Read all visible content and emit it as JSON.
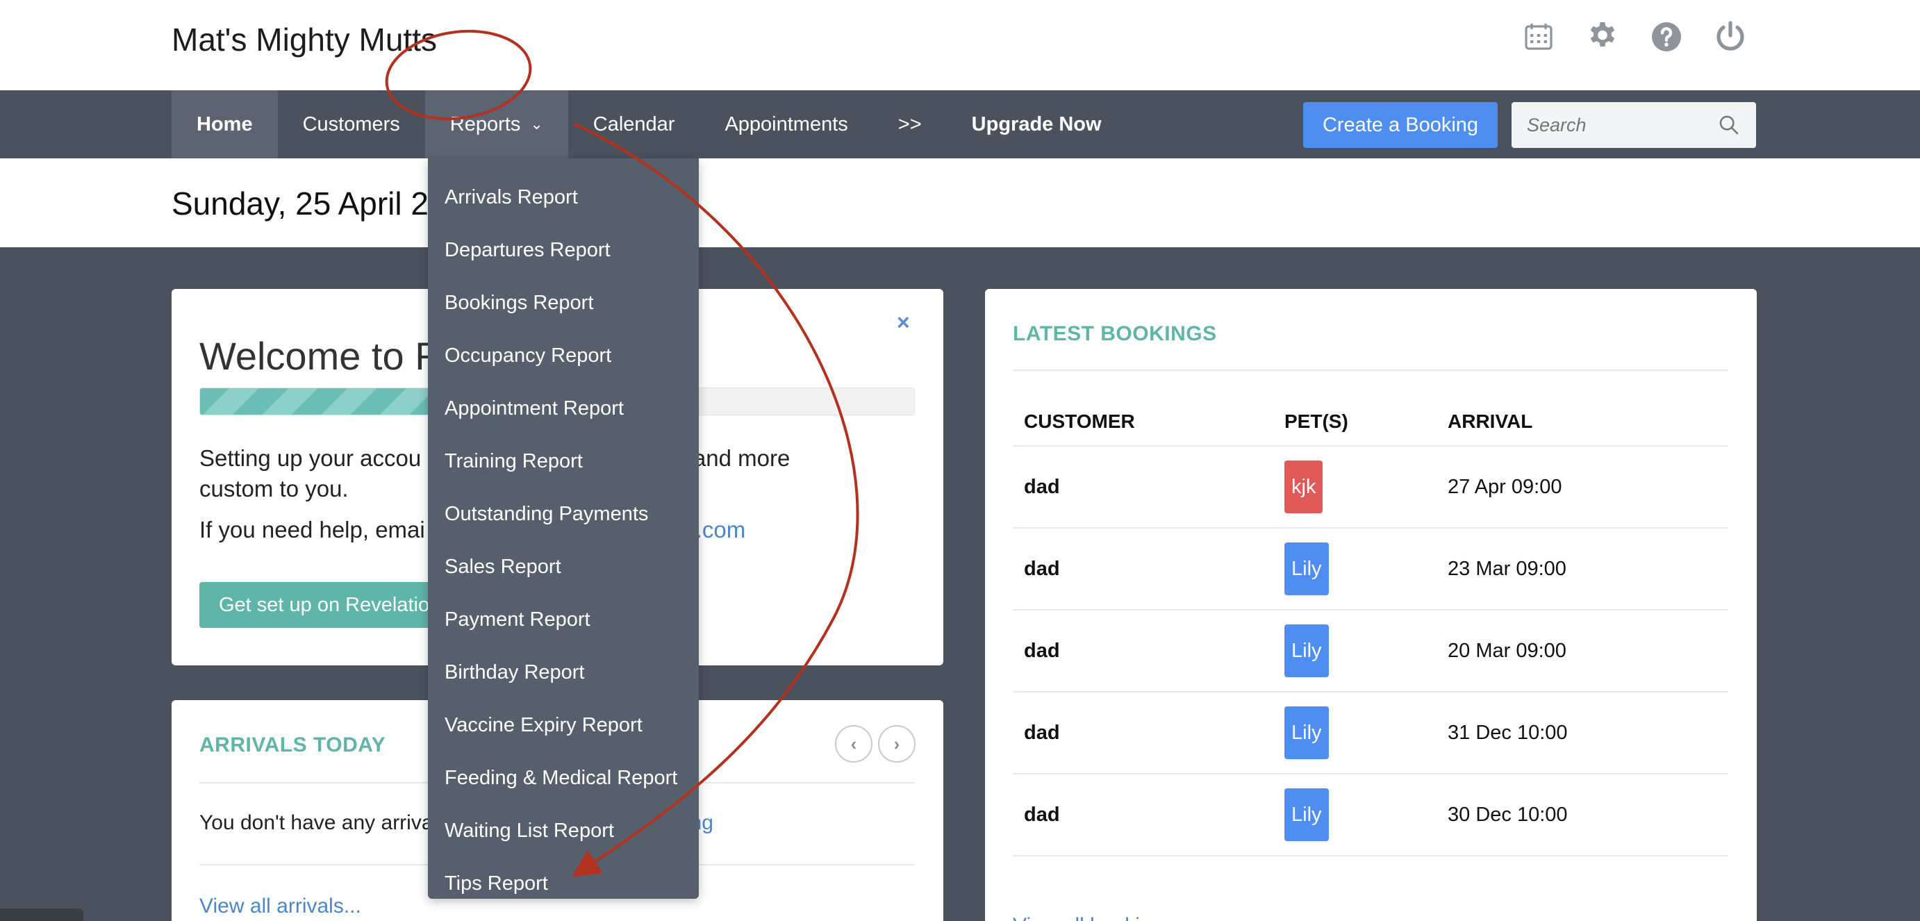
{
  "header": {
    "brand": "Mat's Mighty Mutts",
    "icons": [
      "calendar-icon",
      "gear-icon",
      "help-icon",
      "power-icon"
    ]
  },
  "nav": {
    "items": [
      {
        "label": "Home",
        "state": "active"
      },
      {
        "label": "Customers",
        "state": ""
      },
      {
        "label": "Reports",
        "state": "open"
      },
      {
        "label": "Calendar",
        "state": ""
      },
      {
        "label": "Appointments",
        "state": ""
      },
      {
        "label": ">>",
        "state": ""
      },
      {
        "label": "Upgrade Now",
        "state": "bold"
      }
    ],
    "create_button": "Create a Booking",
    "search_placeholder": "Search"
  },
  "date_title": "Sunday, 25 April 2",
  "reports_menu": [
    "Arrivals Report",
    "Departures Report",
    "Bookings Report",
    "Occupancy Report",
    "Appointment Report",
    "Training Report",
    "Outstanding Payments",
    "Sales Report",
    "Payment Report",
    "Birthday Report",
    "Vaccine Expiry Report",
    "Feeding & Medical Report",
    "Waiting List Report",
    "Tips Report"
  ],
  "welcome": {
    "title": "Welcome to R",
    "close": "×",
    "progress_percent": 67,
    "line1_a": "Setting up your accou",
    "line1_b": "faster and more",
    "line2": "custom to you.",
    "help_a": "If you need help, emai",
    "help_link": ".com",
    "setup_button": "Get set up on Revelatio"
  },
  "arrivals": {
    "title": "ARRIVALS TODAY",
    "prev": "‹",
    "next": "›",
    "empty_a": "You don't have any arriva",
    "empty_link": "ng",
    "view_all": "View all arrivals..."
  },
  "bookings": {
    "title": "LATEST BOOKINGS",
    "columns": [
      "CUSTOMER",
      "PET(S)",
      "ARRIVAL"
    ],
    "rows": [
      {
        "customer": "dad",
        "pet": "kjk",
        "pet_color": "#e05a5a",
        "arrival": "27 Apr 09:00"
      },
      {
        "customer": "dad",
        "pet": "Lily",
        "pet_color": "#4f8ef0",
        "arrival": "23 Mar 09:00"
      },
      {
        "customer": "dad",
        "pet": "Lily",
        "pet_color": "#4f8ef0",
        "arrival": "20 Mar 09:00"
      },
      {
        "customer": "dad",
        "pet": "Lily",
        "pet_color": "#4f8ef0",
        "arrival": "31 Dec 10:00"
      },
      {
        "customer": "dad",
        "pet": "Lily",
        "pet_color": "#4f8ef0",
        "arrival": "30 Dec 10:00"
      }
    ],
    "view_all": "View all bookings..."
  },
  "colors": {
    "nav_bg": "#4a525e",
    "accent_teal": "#5fb5a8",
    "accent_blue": "#4f8ef0",
    "annotation_red": "#b3321f"
  }
}
